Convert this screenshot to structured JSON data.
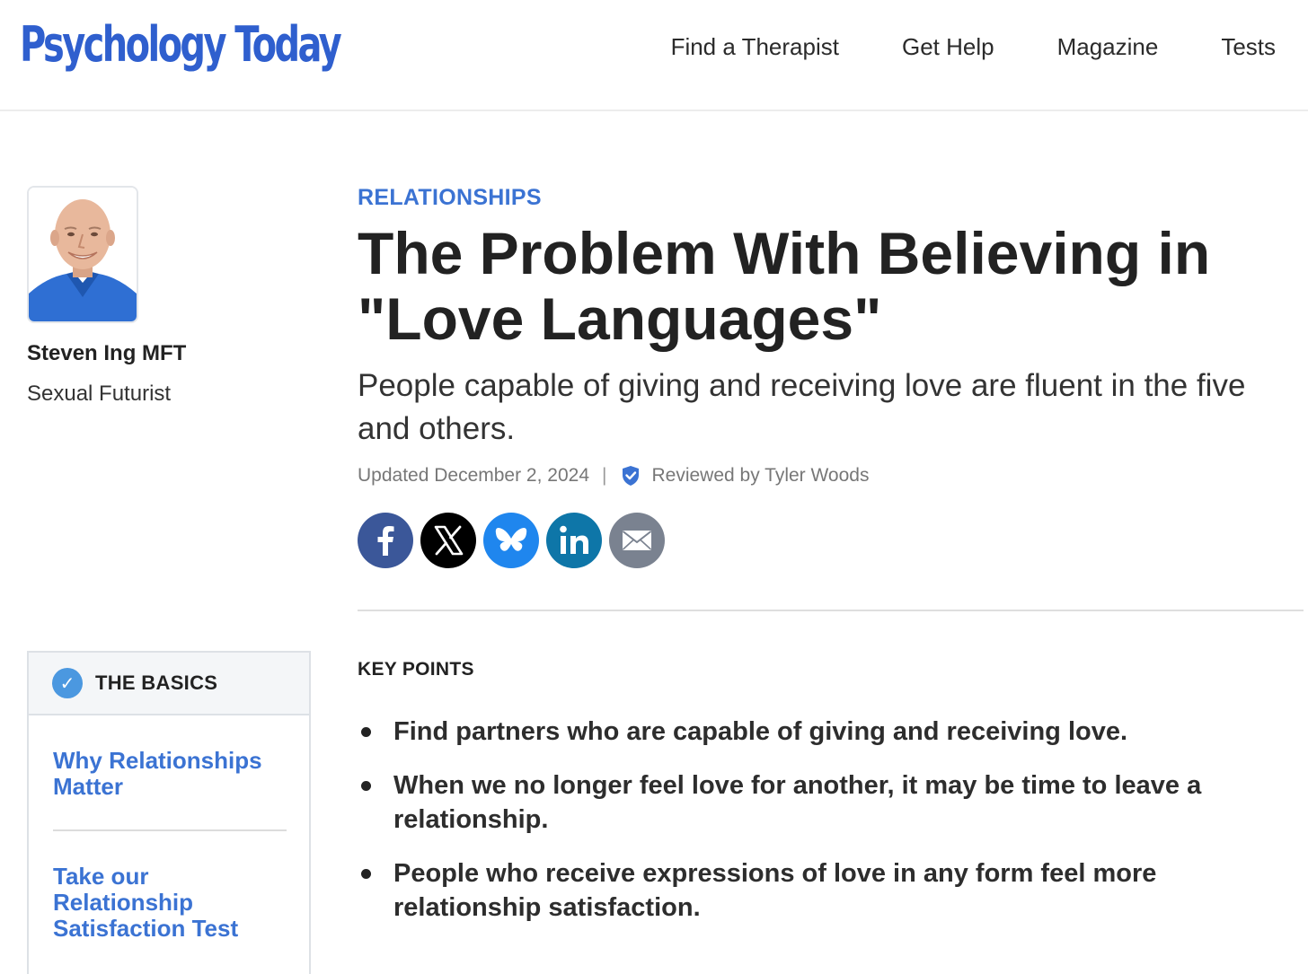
{
  "header": {
    "logo_text": "Psychology Today",
    "nav": [
      "Find a Therapist",
      "Get Help",
      "Magazine",
      "Tests"
    ]
  },
  "author": {
    "name": "Steven Ing MFT",
    "title": "Sexual Futurist"
  },
  "basics": {
    "title": "THE BASICS",
    "links": [
      "Why Relationships Matter",
      "Take our Relationship Satisfaction Test"
    ]
  },
  "article": {
    "category": "RELATIONSHIPS",
    "headline": "The Problem With Believing in \"Love Languages\"",
    "subheadline": "People capable of giving and receiving love are fluent in the five and others.",
    "updated": "Updated December 2, 2024",
    "separator": "|",
    "reviewed": "Reviewed by Tyler Woods"
  },
  "share": {
    "icons": [
      "facebook-icon",
      "x-icon",
      "bluesky-icon",
      "linkedin-icon",
      "email-icon"
    ]
  },
  "key_points": {
    "title": "KEY POINTS",
    "items": [
      "Find partners who are capable of giving and receiving love.",
      "When we no longer feel love for another, it may be time to leave a relationship.",
      "People who receive expressions of love in any form feel more relationship satisfaction."
    ]
  },
  "colors": {
    "brand_blue": "#2f5fce",
    "link_blue": "#3b73d3",
    "facebook": "#3b5799",
    "x": "#000000",
    "bluesky": "#1f86ee",
    "linkedin": "#0e76a8",
    "email": "#7a8290"
  }
}
